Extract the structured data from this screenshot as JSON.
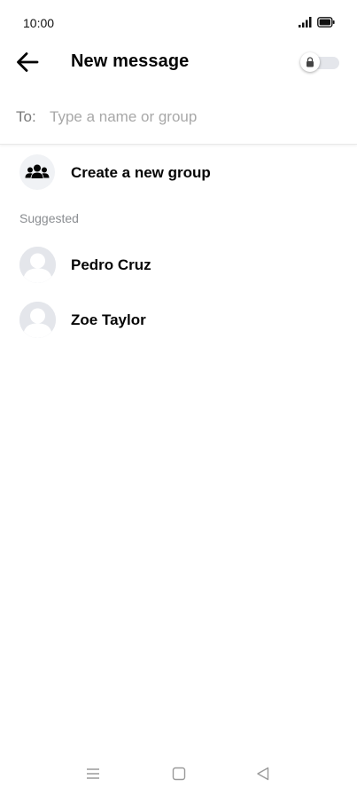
{
  "status_bar": {
    "time": "10:00"
  },
  "header": {
    "title": "New message"
  },
  "to_field": {
    "label": "To:",
    "placeholder": "Type a name or group",
    "value": ""
  },
  "create_group": {
    "label": "Create a new group"
  },
  "suggested": {
    "heading": "Suggested",
    "contacts": [
      {
        "name": "Pedro Cruz"
      },
      {
        "name": "Zoe Taylor"
      }
    ]
  },
  "icons": {
    "back": "arrow-left-icon",
    "secret_toggle": "lock-icon",
    "group": "group-people-icon",
    "nav_menu": "menu-icon",
    "nav_home": "home-square-icon",
    "nav_back": "back-triangle-icon"
  },
  "colors": {
    "text": "#050505",
    "secondary_text": "#8a8d91",
    "placeholder": "#a8a8a8",
    "icon_bg": "#f0f2f5"
  }
}
